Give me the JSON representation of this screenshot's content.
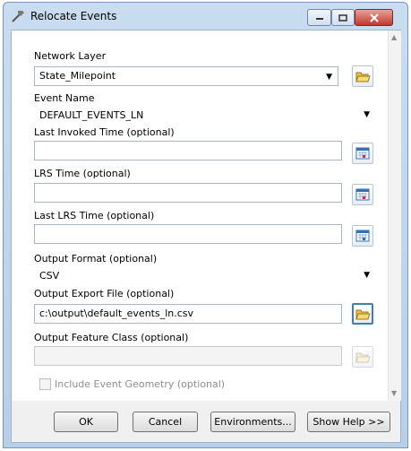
{
  "window": {
    "title": "Relocate Events"
  },
  "fields": {
    "network_layer": {
      "label": "Network Layer",
      "value": "State_Milepoint"
    },
    "event_name": {
      "label": "Event Name",
      "value": "DEFAULT_EVENTS_LN"
    },
    "last_invoked_time": {
      "label": "Last Invoked Time (optional)",
      "value": ""
    },
    "lrs_time": {
      "label": "LRS Time (optional)",
      "value": ""
    },
    "last_lrs_time": {
      "label": "Last LRS Time (optional)",
      "value": ""
    },
    "output_format": {
      "label": "Output Format (optional)",
      "value": "CSV"
    },
    "output_export_file": {
      "label": "Output Export File (optional)",
      "value": "c:\\output\\default_events_ln.csv"
    },
    "output_feature_class": {
      "label": "Output Feature Class (optional)",
      "value": ""
    },
    "include_event_geometry": {
      "label": "Include Event Geometry (optional)",
      "checked": false
    }
  },
  "buttons": {
    "ok": "OK",
    "cancel": "Cancel",
    "environments": "Environments...",
    "show_help": "Show Help >>"
  },
  "icons": {
    "title": "hammer-icon",
    "browse": "folder-open-icon",
    "calendar": "calendar-icon"
  },
  "colors": {
    "title_bar": "#c9dcf0",
    "close_button": "#c0392b",
    "active_outline": "#3c7fb1"
  }
}
